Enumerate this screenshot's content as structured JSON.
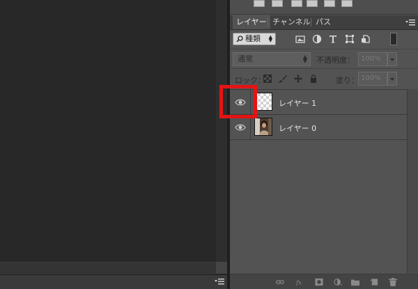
{
  "tabs": [
    {
      "label": "レイヤー",
      "active": true
    },
    {
      "label": "チャンネル",
      "active": false
    },
    {
      "label": "パス",
      "active": false
    }
  ],
  "filter": {
    "kind_label": "種類",
    "icons": [
      "image-filter-icon",
      "adjustment-filter-icon",
      "type-filter-icon",
      "shape-filter-icon",
      "smart-object-filter-icon"
    ]
  },
  "blend": {
    "mode": "通常",
    "opacity_label": "不透明度：",
    "opacity_value": "100%"
  },
  "lock": {
    "label": "ロック：",
    "fill_label": "塗り：",
    "fill_value": "100%"
  },
  "layers": [
    {
      "name": "レイヤー 1",
      "visible": true,
      "thumbnail": "transparent-checker"
    },
    {
      "name": "レイヤー 0",
      "visible": true,
      "thumbnail": "photo"
    }
  ],
  "bottom_icons": [
    "link-layers-icon",
    "fx-icon",
    "mask-icon",
    "adjustment-layer-icon",
    "group-folder-icon",
    "new-layer-icon",
    "trash-icon"
  ],
  "colors": {
    "panel": "#535353",
    "canvas": "#282828",
    "highlight": "#e41414"
  }
}
